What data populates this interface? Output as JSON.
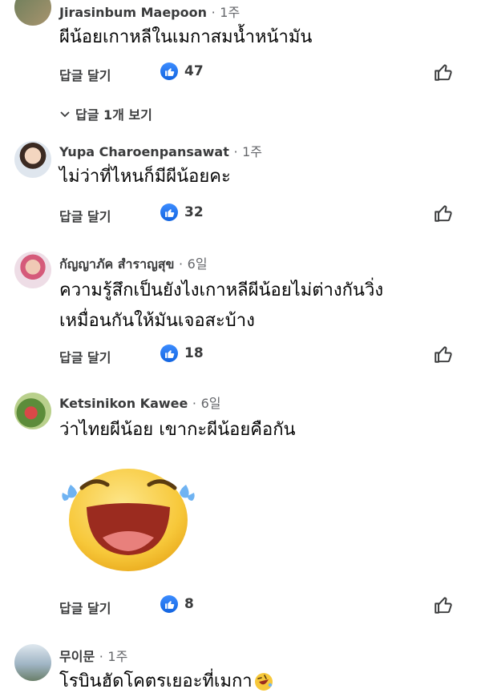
{
  "reply_label": "답글 달기",
  "view_replies_label": "답글 1개 보기",
  "dot": "·",
  "comments": [
    {
      "author": "Jirasinbum Maepoon",
      "time": "1주",
      "text_lines": [
        "ผีน้อยเกาหลีในเมกาสมน้ำหน้ามัน"
      ],
      "likes": "47"
    },
    {
      "author": "Yupa Charoenpansawat",
      "time": "1주",
      "text_lines": [
        "ไม่ว่าที่ไหนก็มีผีน้อยคะ"
      ],
      "likes": "32"
    },
    {
      "author": "กัญญาภัค สำราญสุข",
      "time": "6일",
      "text_lines": [
        "ความรู้สึกเป็นยังไงเกาหลีผีน้อยไม่ต่างกันวิ่ง",
        "เหมื่อนกันให้มันเจอสะบ้าง"
      ],
      "likes": "18"
    },
    {
      "author": "Ketsinikon Kawee",
      "time": "6일",
      "text_lines": [
        "ว่าไทยผีน้อย เขากะผีน้อยคือกัน"
      ],
      "likes": "8",
      "sticker": "laughing-tears-sticker"
    },
    {
      "author": "무이문",
      "time": "1주",
      "text_lines": [
        "โรบินฮัดโคตรเยอะที่เมกา"
      ],
      "emoji": "rolling-laughing-emoji"
    }
  ],
  "colors": {
    "like_blue": "#1877f2",
    "text_primary": "#050505",
    "text_secondary": "#65676b",
    "sticker_yellow": "#f7c83a",
    "tear_blue": "#6fb3f2"
  }
}
